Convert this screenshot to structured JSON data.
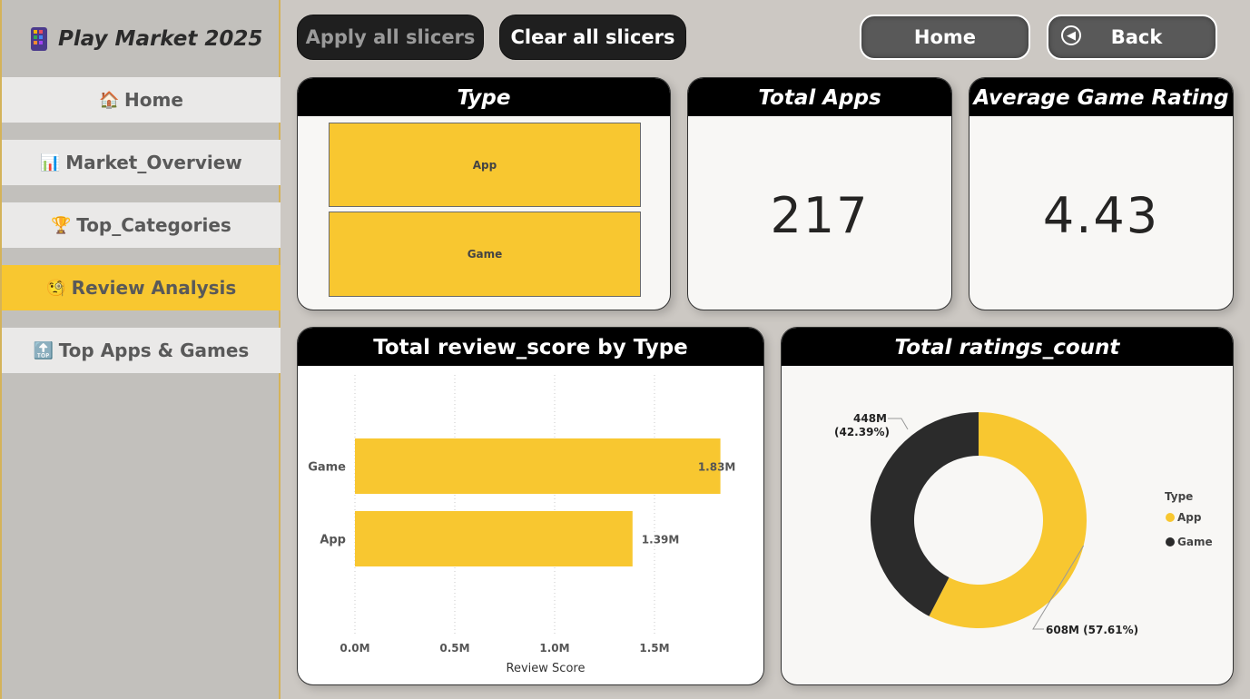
{
  "app": {
    "title": "Play Market 2025"
  },
  "sidebar": {
    "items": [
      {
        "label": "Home",
        "icon": "house-icon"
      },
      {
        "label": "Market_Overview",
        "icon": "bar-chart-icon"
      },
      {
        "label": "Top_Categories",
        "icon": "trophy-icon"
      },
      {
        "label": "Review Analysis",
        "icon": "monocle-face-icon",
        "active": true
      },
      {
        "label": "Top Apps & Games",
        "icon": "top-arrow-icon"
      }
    ]
  },
  "toolbar": {
    "apply_label": "Apply all slicers",
    "clear_label": "Clear all slicers",
    "home_label": "Home",
    "back_label": "Back"
  },
  "type_slicer": {
    "title": "Type",
    "options": [
      "App",
      "Game"
    ]
  },
  "kpis": {
    "total_apps": {
      "title": "Total Apps",
      "value": "217"
    },
    "avg_game_rating": {
      "title": "Average Game Rating",
      "value": "4.43"
    }
  },
  "colors": {
    "accent": "#f8c730",
    "dark": "#2b2b2b",
    "header": "#000000"
  },
  "chart_data": [
    {
      "type": "bar",
      "orientation": "horizontal",
      "title": "Total review_score by Type",
      "xlabel": "Review Score",
      "ylabel": "",
      "categories": [
        "Game",
        "App"
      ],
      "values": [
        1830000,
        1390000
      ],
      "data_labels": [
        "1.83M",
        "1.39M"
      ],
      "xticks": [
        "0.0M",
        "0.5M",
        "1.0M",
        "1.5M"
      ],
      "xtick_values": [
        0,
        500000,
        1000000,
        1500000
      ],
      "xlim": [
        0,
        1950000
      ],
      "grid": "vertical dotted"
    },
    {
      "type": "pie",
      "variant": "donut",
      "title": "Total ratings_count",
      "legend_title": "Type",
      "legend_position": "right",
      "slices": [
        {
          "name": "App",
          "value": 608,
          "label": "608M (57.61%)",
          "color": "#f8c730"
        },
        {
          "name": "Game",
          "value": 448,
          "label_value": "448M",
          "label_pct": "(42.39%)",
          "color": "#2b2b2b"
        }
      ]
    }
  ]
}
